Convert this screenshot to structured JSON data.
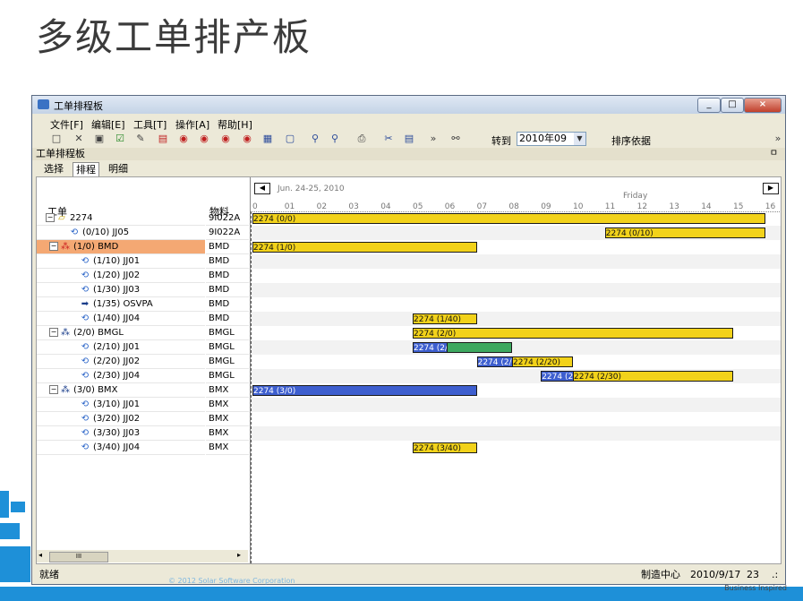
{
  "slide": {
    "title": "多级工单排产板",
    "footer": "© 2012 Solar Software Corporation",
    "tagline": "Business Inspired"
  },
  "window": {
    "title": "工单排程板",
    "controls": [
      "_",
      "□",
      "×"
    ]
  },
  "menu": [
    "文件[F]",
    "编辑[E]",
    "工具[T]",
    "操作[A]",
    "帮助[H]"
  ],
  "toolbar": {
    "goto_label": "转到",
    "goto_value": "2010年09",
    "sort_label": "排序依据"
  },
  "panel": {
    "title": "工单排程板",
    "pin": "ㅁ"
  },
  "tabs": [
    "选择",
    "排程",
    "明细"
  ],
  "grid": {
    "col_work_order": "工单",
    "col_material": "物料",
    "scroll_label": "III",
    "rows": [
      {
        "label": "2274",
        "material": "9I022A"
      },
      {
        "label": "(0/10) JJ05",
        "material": "9I022A"
      },
      {
        "label": "(1/0) BMD",
        "material": "BMD"
      },
      {
        "label": "(1/10) JJ01",
        "material": "BMD"
      },
      {
        "label": "(1/20) JJ02",
        "material": "BMD"
      },
      {
        "label": "(1/30) JJ03",
        "material": "BMD"
      },
      {
        "label": "(1/35) OSVPA",
        "material": "BMD"
      },
      {
        "label": "(1/40) JJ04",
        "material": "BMD"
      },
      {
        "label": "(2/0) BMGL",
        "material": "BMGL"
      },
      {
        "label": "(2/10) JJ01",
        "material": "BMGL"
      },
      {
        "label": "(2/20) JJ02",
        "material": "BMGL"
      },
      {
        "label": "(2/30) JJ04",
        "material": "BMGL"
      },
      {
        "label": "(3/0) BMX",
        "material": "BMX"
      },
      {
        "label": "(3/10) JJ01",
        "material": "BMX"
      },
      {
        "label": "(3/20) JJ02",
        "material": "BMX"
      },
      {
        "label": "(3/30) JJ03",
        "material": "BMX"
      },
      {
        "label": "(3/40) JJ04",
        "material": "BMX"
      }
    ]
  },
  "gantt": {
    "date_range": "Jun. 24-25, 2010",
    "day": "Friday",
    "hours": [
      "0",
      "01",
      "02",
      "03",
      "04",
      "05",
      "06",
      "07",
      "08",
      "09",
      "10",
      "11",
      "12",
      "13",
      "14",
      "15",
      "16"
    ],
    "bars": [
      {
        "row": 0,
        "start": 0,
        "end": 16,
        "color": "yellow",
        "label": "2274 (0/0)"
      },
      {
        "row": 1,
        "start": 11,
        "end": 16,
        "color": "yellow",
        "label": "2274 (0/10)"
      },
      {
        "row": 2,
        "start": 0,
        "end": 7,
        "color": "yellow",
        "label": "2274 (1/0)"
      },
      {
        "row": 7,
        "start": 5,
        "end": 7,
        "color": "yellow",
        "label": "2274 (1/40)"
      },
      {
        "row": 8,
        "start": 5,
        "end": 15,
        "color": "yellow",
        "label": "2274 (2/0)"
      },
      {
        "row": 9,
        "start": 5,
        "end": 7,
        "color": "blue",
        "label": "2274 (2/"
      },
      {
        "row": 9,
        "start": 6.05,
        "end": 8.1,
        "color": "green",
        "label": ""
      },
      {
        "row": 10,
        "start": 7,
        "end": 9,
        "color": "blue",
        "label": "2274 (2/"
      },
      {
        "row": 10,
        "start": 8.1,
        "end": 10,
        "color": "yellow",
        "label": "2274 (2/20)"
      },
      {
        "row": 11,
        "start": 9,
        "end": 11,
        "color": "blue",
        "label": "2274 (2/"
      },
      {
        "row": 11,
        "start": 10,
        "end": 15,
        "color": "yellow",
        "label": "2274 (2/30)"
      },
      {
        "row": 12,
        "start": 0,
        "end": 7,
        "color": "blue",
        "label": "2274 (3/0)"
      },
      {
        "row": 16,
        "start": 5,
        "end": 7,
        "color": "yellow",
        "label": "2274 (3/40)"
      }
    ]
  },
  "status": {
    "ready": "就绪",
    "center": "制造中心",
    "date": "2010/9/17",
    "count": "23"
  }
}
